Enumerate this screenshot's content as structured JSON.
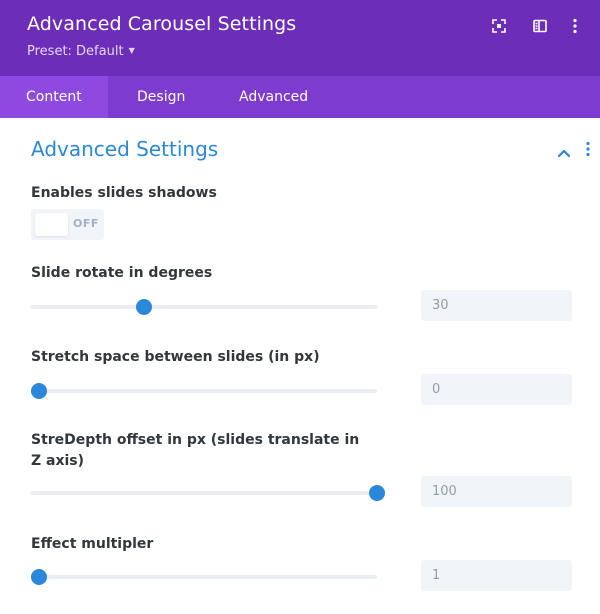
{
  "header": {
    "title": "Advanced Carousel Settings",
    "preset_label": "Preset: Default",
    "background_color": "#6c2eb9",
    "icons": [
      "expand-icon",
      "sidebar-toggle-icon",
      "more-vertical-icon"
    ]
  },
  "tabs": [
    {
      "label": "Content",
      "active": true
    },
    {
      "label": "Design",
      "active": false
    },
    {
      "label": "Advanced",
      "active": false
    }
  ],
  "section": {
    "title": "Advanced Settings",
    "expanded": true,
    "accent_color": "#2b87da",
    "icons": [
      "chevron-up-icon",
      "more-vertical-icon"
    ]
  },
  "settings": {
    "shadows": {
      "label": "Enables slides shadows",
      "state": "OFF",
      "enabled": false
    },
    "rotate": {
      "label": "Slide rotate in degrees",
      "value": "30",
      "slider_fraction": 0.31
    },
    "stretch": {
      "label": "Stretch space between slides (in px)",
      "value": "0",
      "slider_fraction": 0.0
    },
    "depth": {
      "label": "StreDepth offset in px (slides translate in Z axis)",
      "value": "100",
      "slider_fraction": 1.0
    },
    "multiplier": {
      "label": "Effect multipler",
      "value": "1",
      "slider_fraction": 0.0
    }
  }
}
